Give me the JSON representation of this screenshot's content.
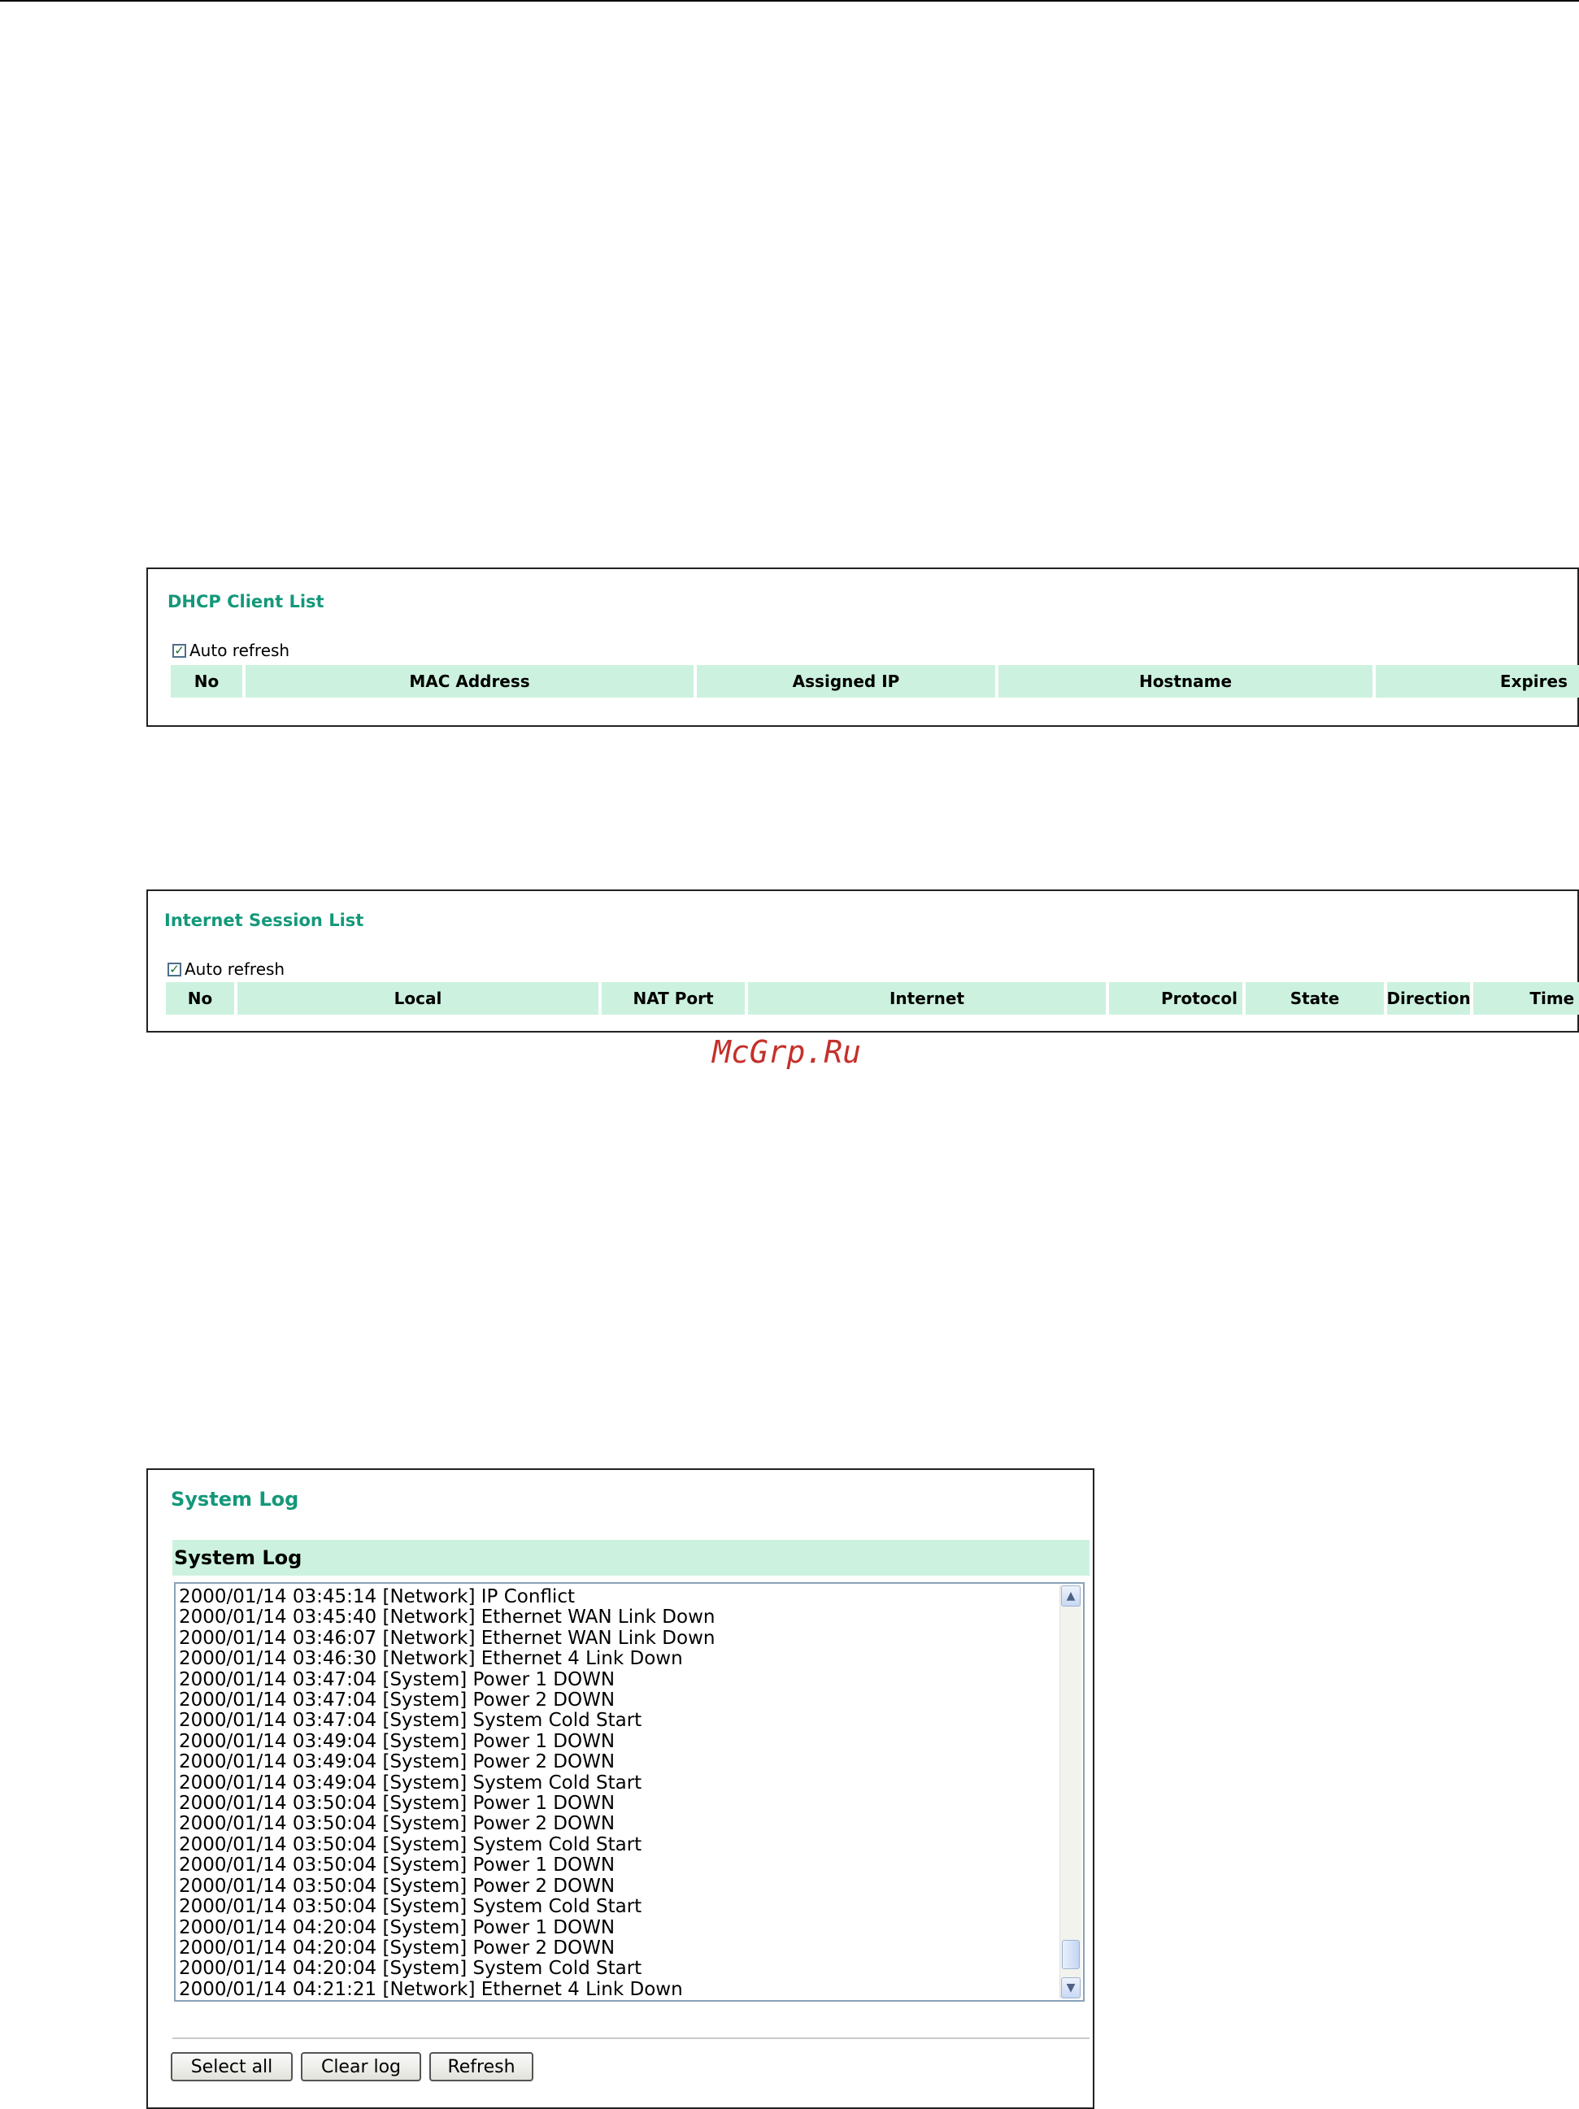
{
  "dhcp": {
    "title": "DHCP Client List",
    "auto_refresh_label": "Auto refresh",
    "auto_refresh_checked": true,
    "columns": [
      "No",
      "MAC Address",
      "Assigned IP",
      "Hostname",
      "Expires"
    ]
  },
  "session": {
    "title": "Internet Session List",
    "auto_refresh_label": "Auto refresh",
    "auto_refresh_checked": true,
    "columns": [
      "No",
      "Local",
      "NAT Port",
      "Internet",
      "Protocol",
      "State",
      "Direction",
      "Time Out"
    ]
  },
  "watermark": "McGrp.Ru",
  "syslog": {
    "title": "System Log",
    "section_label": "System Log",
    "entries": [
      "2000/01/14 03:45:14 [Network] IP Conflict",
      "2000/01/14 03:45:40 [Network] Ethernet WAN Link Down",
      "2000/01/14 03:46:07 [Network] Ethernet WAN Link Down",
      "2000/01/14 03:46:30 [Network] Ethernet 4 Link Down",
      "2000/01/14 03:47:04 [System] Power 1 DOWN",
      "2000/01/14 03:47:04 [System] Power 2 DOWN",
      "2000/01/14 03:47:04 [System] System Cold Start",
      "2000/01/14 03:49:04 [System] Power 1 DOWN",
      "2000/01/14 03:49:04 [System] Power 2 DOWN",
      "2000/01/14 03:49:04 [System] System Cold Start",
      "2000/01/14 03:50:04 [System] Power 1 DOWN",
      "2000/01/14 03:50:04 [System] Power 2 DOWN",
      "2000/01/14 03:50:04 [System] System Cold Start",
      "2000/01/14 03:50:04 [System] Power 1 DOWN",
      "2000/01/14 03:50:04 [System] Power 2 DOWN",
      "2000/01/14 03:50:04 [System] System Cold Start",
      "2000/01/14 04:20:04 [System] Power 1 DOWN",
      "2000/01/14 04:20:04 [System] Power 2 DOWN",
      "2000/01/14 04:20:04 [System] System Cold Start",
      "2000/01/14 04:21:21 [Network] Ethernet 4 Link Down"
    ],
    "buttons": {
      "select_all": "Select all",
      "clear_log": "Clear log",
      "refresh": "Refresh"
    }
  },
  "colors": {
    "title_green": "#14987a",
    "header_bg": "#ccf2df",
    "watermark_red": "#c5302b"
  },
  "icons": {
    "checkbox": "check-icon",
    "scroll_up": "chevron-up-icon",
    "scroll_down": "chevron-down-icon"
  }
}
